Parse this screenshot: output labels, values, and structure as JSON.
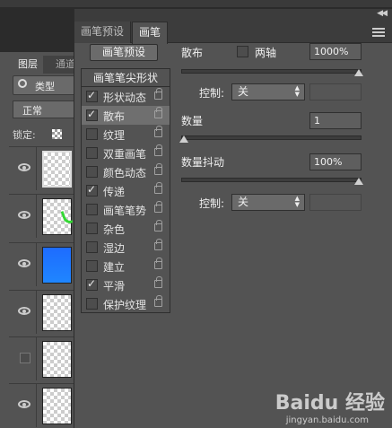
{
  "layers": {
    "tabs": [
      "图层",
      "通道"
    ],
    "filter_label": "类型",
    "blend_mode": "正常",
    "lock_label": "锁定:"
  },
  "brush_panel": {
    "tabs": [
      "画笔预设",
      "画笔"
    ],
    "active_tab": "画笔",
    "presets_button": "画笔预设",
    "list_header": "画笔笔尖形状",
    "items": [
      {
        "label": "形状动态",
        "checked": true
      },
      {
        "label": "散布",
        "checked": true
      },
      {
        "label": "纹理",
        "checked": false
      },
      {
        "label": "双重画笔",
        "checked": false
      },
      {
        "label": "颜色动态",
        "checked": false
      },
      {
        "label": "传递",
        "checked": true
      },
      {
        "label": "画笔笔势",
        "checked": false
      },
      {
        "label": "杂色",
        "checked": false
      },
      {
        "label": "湿边",
        "checked": false
      },
      {
        "label": "建立",
        "checked": false
      },
      {
        "label": "平滑",
        "checked": true
      },
      {
        "label": "保护纹理",
        "checked": false
      }
    ],
    "selected_item": "散布",
    "scatter": {
      "label": "散布",
      "both_axes_label": "两轴",
      "value": "1000%",
      "level": 1.0
    },
    "control1": {
      "label": "控制:",
      "value": "关"
    },
    "count": {
      "label": "数量",
      "value": "1",
      "level": 0.0
    },
    "count_jitter": {
      "label": "数量抖动",
      "value": "100%",
      "level": 1.0
    },
    "control2": {
      "label": "控制:",
      "value": "关"
    }
  },
  "watermark": {
    "text": "Baidu 经验",
    "sub": "jingyan.baidu.com"
  }
}
